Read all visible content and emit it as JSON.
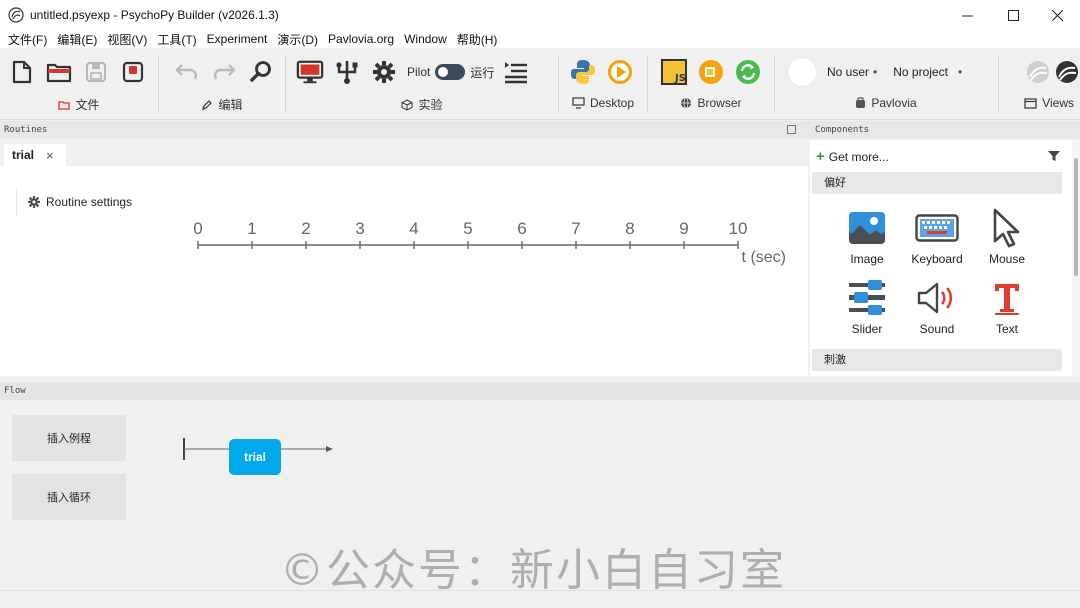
{
  "window": {
    "title": "untitled.psyexp - PsychoPy Builder (v2026.1.3)",
    "controls": [
      "minimize-icon",
      "maximize-icon",
      "close-icon"
    ]
  },
  "menubar": {
    "items": [
      "文件(F)",
      "编辑(E)",
      "视图(V)",
      "工具(T)",
      "Experiment",
      "演示(D)",
      "Pavlovia.org",
      "Window",
      "帮助(H)"
    ]
  },
  "toolbar": {
    "groups": [
      {
        "label": "文件",
        "icons": [
          "new-file-icon",
          "open-folder-icon",
          "save-icon",
          "save-as-icon"
        ]
      },
      {
        "label": "编辑",
        "icons": [
          "undo-icon",
          "redo-icon",
          "find-icon"
        ]
      },
      {
        "label": "实验",
        "icons": [
          "monitor-icon",
          "hardware-icon",
          "settings-gear-icon"
        ]
      },
      {
        "label": "Desktop",
        "icons": [
          "python-icon",
          "run-icon"
        ]
      },
      {
        "label": "Browser",
        "icons": [
          "js-icon",
          "run-online-icon",
          "sync-icon"
        ]
      },
      {
        "label": "Pavlovia",
        "icons": [
          "user-avatar"
        ]
      },
      {
        "label": "Views",
        "icons": [
          "builder-view-icon",
          "coder-view-icon"
        ]
      }
    ],
    "pilot_label": "Pilot",
    "run_label": "运行",
    "user_label": "No user",
    "project_label": "No project",
    "dot": "•"
  },
  "routines": {
    "panel_title": "Routines",
    "tab_label": "trial",
    "tab_close": "×",
    "settings_label": "Routine settings",
    "timeline": {
      "ticks": [
        "0",
        "1",
        "2",
        "3",
        "4",
        "5",
        "6",
        "7",
        "8",
        "9",
        "10"
      ],
      "unit_label": "t (sec)"
    }
  },
  "components": {
    "panel_title": "Components",
    "get_more": "Get more...",
    "categories": [
      {
        "name": "偏好",
        "items": [
          {
            "label": "Image",
            "icon": "image-icon"
          },
          {
            "label": "Keyboard",
            "icon": "keyboard-icon"
          },
          {
            "label": "Mouse",
            "icon": "mouse-cursor-icon"
          },
          {
            "label": "Slider",
            "icon": "slider-icon"
          },
          {
            "label": "Sound",
            "icon": "sound-icon"
          },
          {
            "label": "Text",
            "icon": "text-icon"
          }
        ]
      },
      {
        "name": "刺激",
        "items": []
      }
    ],
    "colors": {
      "text_icon": "#e03c31",
      "sound_wave": "#e03c31",
      "image_blue": "#2f8fd8"
    }
  },
  "flow": {
    "panel_title": "Flow",
    "insert_routine": "插入例程",
    "insert_loop": "插入循环",
    "routine_box": "trial",
    "colors": {
      "routine_box": "#02a9ea"
    }
  },
  "watermark": "©公众号：新小白自习室"
}
